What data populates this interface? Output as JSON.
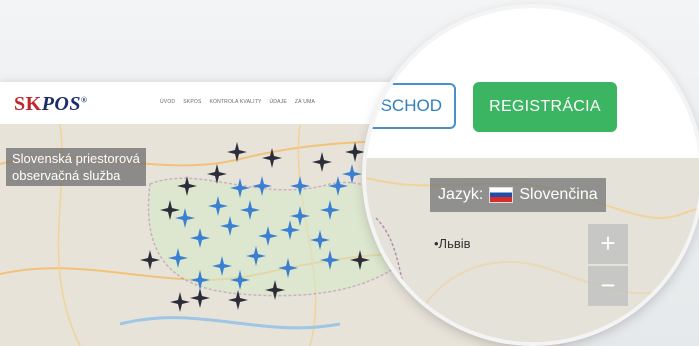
{
  "header": {
    "logo_sk": "SK",
    "logo_pos": "POS",
    "logo_reg": "®",
    "nav": [
      "ÚVOD",
      "SKPOS",
      "KONTROLA KVALITY",
      "ÚDAJE",
      "ZÁ UMA"
    ]
  },
  "map": {
    "title_line1": "Slovenská priestorová",
    "title_line2": "observačná služba"
  },
  "magnifier": {
    "login_label": "SCHOD",
    "register_label": "REGISTRÁCIA",
    "language_prefix": "Jazyk:",
    "language_value": "Slovenčina",
    "city": "•Львів",
    "zoom_in": "+",
    "zoom_out": "−"
  },
  "colors": {
    "register": "#3cb563",
    "login_border": "#4a90c8",
    "station_blue": "#3b7fd1",
    "station_dark": "#2d2d3a"
  }
}
